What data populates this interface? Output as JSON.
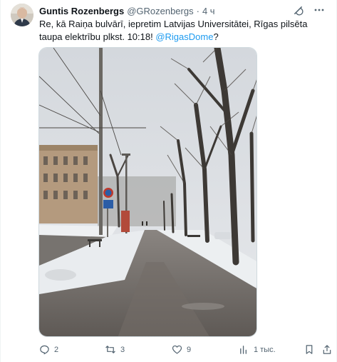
{
  "tweet": {
    "author_name": "Guntis Rozenbergs",
    "author_handle": "@GRozenbergs",
    "separator": "·",
    "time": "4 ч",
    "text_before": "Re, kā Raiņa bulvārī, iepretim Latvijas Universitātei, Rīgas pilsēta taupa elektrību plkst. 10:18! ",
    "mention": "@RigasDome",
    "text_after": "?"
  },
  "actions": {
    "replies": "2",
    "retweets": "3",
    "likes": "9",
    "views": "1 тыс."
  },
  "colors": {
    "accent": "#1d9bf0",
    "secondary_text": "#536471",
    "border": "#cfd9de"
  },
  "icons": {
    "avatar": "avatar",
    "grok": "grok-icon",
    "more": "more-icon",
    "reply": "reply-icon",
    "retweet": "retweet-icon",
    "like": "heart-icon",
    "views": "views-icon",
    "bookmark": "bookmark-icon",
    "share": "share-icon"
  }
}
